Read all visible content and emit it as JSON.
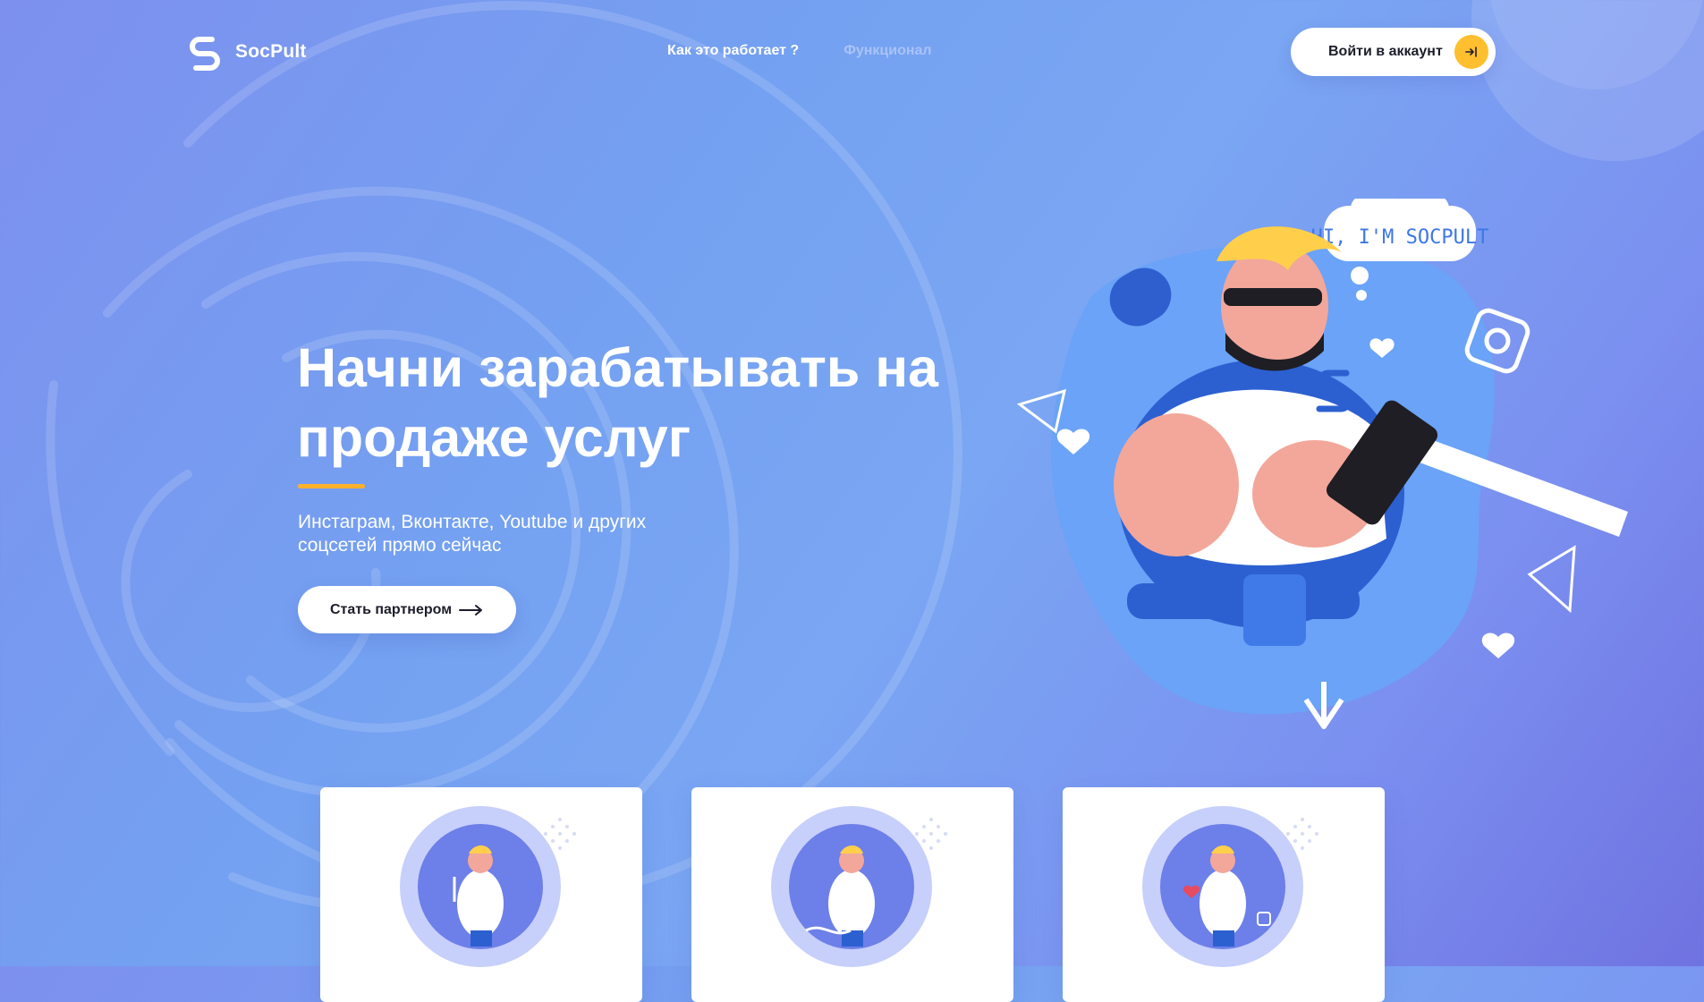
{
  "brand": {
    "name": "SocPult",
    "accent": "#ffb12b",
    "primary_bg": "#74a1f1"
  },
  "nav": {
    "items": [
      {
        "label": "Как это работает ?",
        "active": true
      },
      {
        "label": "Функционал",
        "active": false
      }
    ]
  },
  "login": {
    "label": "Войти в аккаунт",
    "icon": "login-arrow-icon"
  },
  "hero": {
    "title": "Начни зарабатывать на продаже услуг",
    "subtitle": "Инстаграм, Вконтакте, Youtube и других соцсетей прямо сейчас",
    "cta_label": "Стать партнером",
    "speech_bubble": "HI, I'M SOCPULT"
  },
  "cards": [
    {
      "icon": "mascot-pencil-illustration"
    },
    {
      "icon": "mascot-cable-illustration"
    },
    {
      "icon": "mascot-social-illustration"
    }
  ]
}
